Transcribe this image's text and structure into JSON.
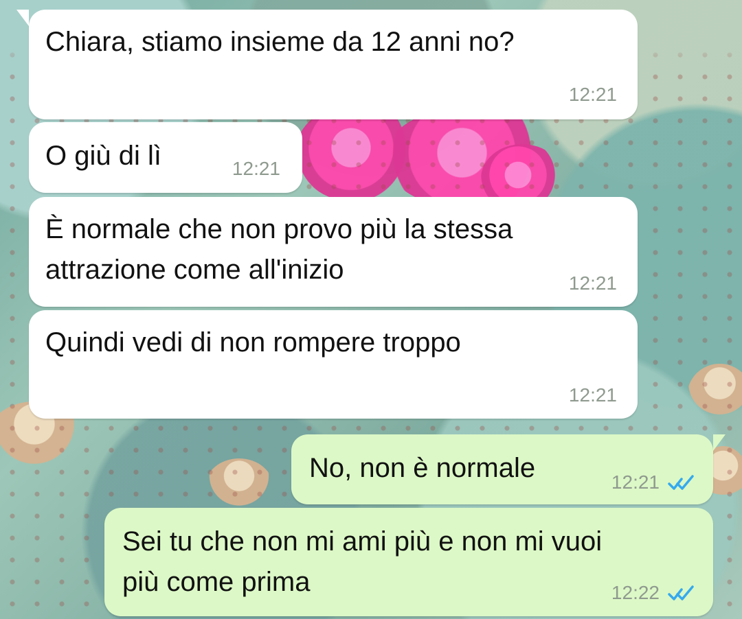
{
  "messages": [
    {
      "id": "m1",
      "direction": "incoming",
      "text": "Chiara, stiamo insieme da 12 anni no?",
      "time": "12:21"
    },
    {
      "id": "m2",
      "direction": "incoming",
      "text": "O giù di lì",
      "time": "12:21"
    },
    {
      "id": "m3",
      "direction": "incoming",
      "text": "È normale che non provo più la stessa\nattrazione come all'inizio",
      "time": "12:21"
    },
    {
      "id": "m4",
      "direction": "incoming",
      "text": "Quindi vedi di non rompere troppo",
      "time": "12:21"
    },
    {
      "id": "m5",
      "direction": "outgoing",
      "text": "No, non è normale",
      "time": "12:21",
      "status_icon": "double-check-read-icon"
    },
    {
      "id": "m6",
      "direction": "outgoing",
      "text": "Sei tu che non mi ami più e non mi vuoi\npiù come prima",
      "time": "12:22",
      "status_icon": "double-check-read-icon"
    }
  ],
  "theme": {
    "incoming_bubble": "#ffffff",
    "outgoing_bubble": "#dcf8c6",
    "timestamp": "#8f9a8f",
    "read_receipt": "#35a9ee"
  }
}
